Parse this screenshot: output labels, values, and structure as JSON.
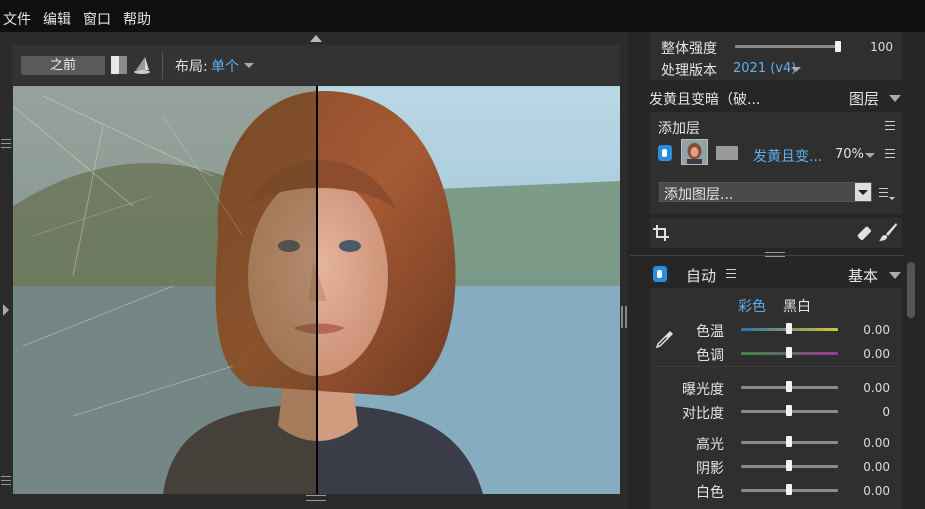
{
  "menubar": {
    "items": [
      {
        "label": "文件"
      },
      {
        "label": "编辑"
      },
      {
        "label": "窗口"
      },
      {
        "label": "帮助"
      }
    ]
  },
  "canvas_toolbar": {
    "before_label": "之前",
    "layout_label": "布局:",
    "layout_value": "单个"
  },
  "right_panel": {
    "strength_label": "整体强度",
    "strength_value": "100",
    "strength_level": 1.0,
    "version_label": "处理版本",
    "version_value": "2021 (v4)",
    "preset_title": "发黄且变暗（破...",
    "layers_label": "图层",
    "add_layer_header": "添加层",
    "layer_name": "发黄且变...",
    "layer_opacity": "70%",
    "add_layer_select": "添加图层...",
    "auto_label": "自动",
    "basic_label": "基本",
    "color_tab": "彩色",
    "bw_tab": "黑白",
    "sliders": [
      {
        "label": "色温",
        "value": "0.00",
        "level": 0.5
      },
      {
        "label": "色调",
        "value": "0.00",
        "level": 0.5
      },
      {
        "label": "曝光度",
        "value": "0.00",
        "level": 0.5
      },
      {
        "label": "对比度",
        "value": "0",
        "level": 0.5
      },
      {
        "label": "高光",
        "value": "0.00",
        "level": 0.5
      },
      {
        "label": "阴影",
        "value": "0.00",
        "level": 0.5
      },
      {
        "label": "白色",
        "value": "0.00",
        "level": 0.5
      }
    ]
  },
  "colors": {
    "accent": "#5fb0ee",
    "toggle_blue": "#2a8ee0"
  }
}
